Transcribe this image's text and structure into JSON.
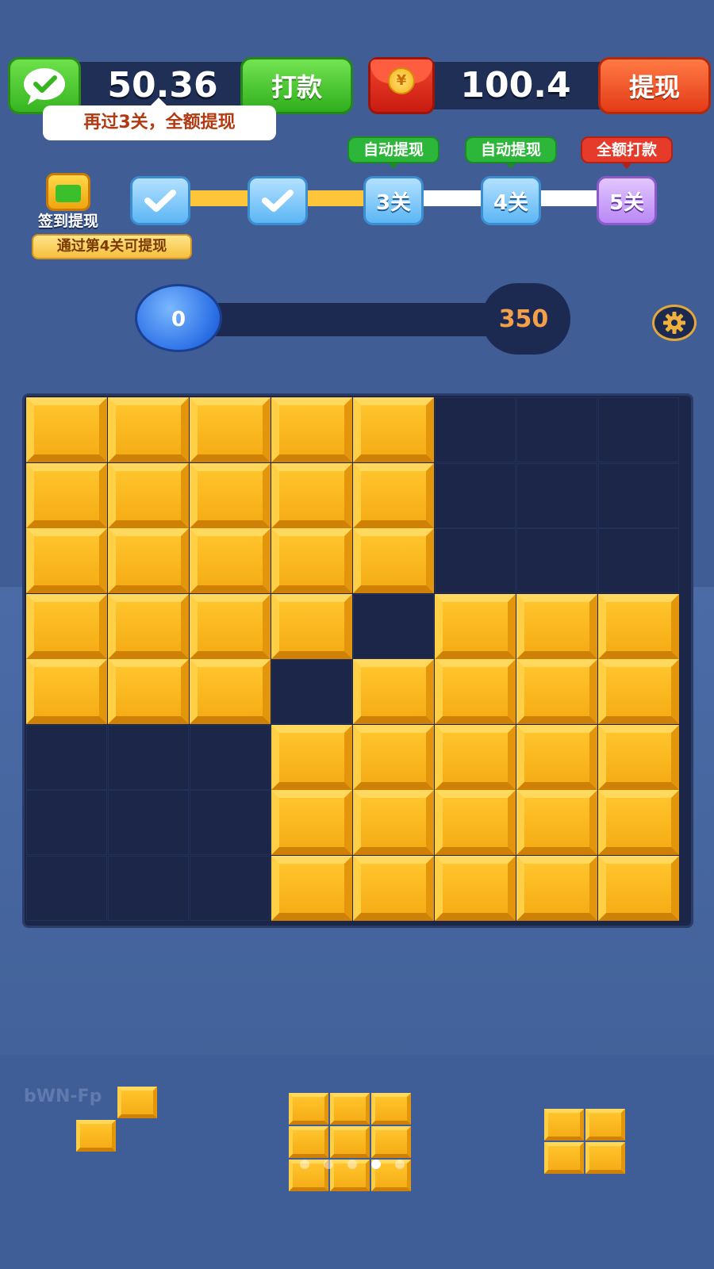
{
  "wallet": {
    "balance": "50.36",
    "pay_button": "打款",
    "tip": "再过3关，全额提现"
  },
  "red_packet": {
    "amount": "100.4",
    "coin_symbol": "¥",
    "withdraw_button": "提现"
  },
  "checkin": {
    "label": "签到提现",
    "pass_tip": "通过第4关可提现"
  },
  "levels": [
    {
      "label": "",
      "status": "done"
    },
    {
      "label": "",
      "status": "done"
    },
    {
      "label": "3关",
      "tag": "自动提现",
      "status": "current"
    },
    {
      "label": "4关",
      "tag": "自动提现",
      "status": "locked"
    },
    {
      "label": "5关",
      "tag": "全额打款",
      "status": "locked"
    }
  ],
  "score": {
    "current": "0",
    "target": "350"
  },
  "board": {
    "cols": 8,
    "rows": 8,
    "filled": [
      "11111000",
      "11111000",
      "11111000",
      "11110111",
      "11101111",
      "00011111",
      "00011111",
      "00011111"
    ]
  },
  "watermark": "bWN-Fp",
  "pieces": [
    {
      "name": "piece-diagonal",
      "cells": [
        [
          0,
          1
        ],
        [
          1,
          0
        ]
      ]
    },
    {
      "name": "piece-3x3",
      "cells": [
        [
          0,
          0
        ],
        [
          0,
          1
        ],
        [
          0,
          2
        ],
        [
          1,
          0
        ],
        [
          1,
          1
        ],
        [
          1,
          2
        ],
        [
          2,
          0
        ],
        [
          2,
          1
        ],
        [
          2,
          2
        ]
      ]
    },
    {
      "name": "piece-2x2",
      "cells": [
        [
          0,
          0
        ],
        [
          0,
          1
        ],
        [
          1,
          0
        ],
        [
          1,
          1
        ]
      ]
    }
  ],
  "page_dots": {
    "count": 5,
    "active": 3
  },
  "colors": {
    "block": "#f6b51b",
    "board": "#1b2648",
    "green_button": "#2fae1d",
    "red_button": "#e33b16",
    "score_target": "#f4a04a"
  }
}
